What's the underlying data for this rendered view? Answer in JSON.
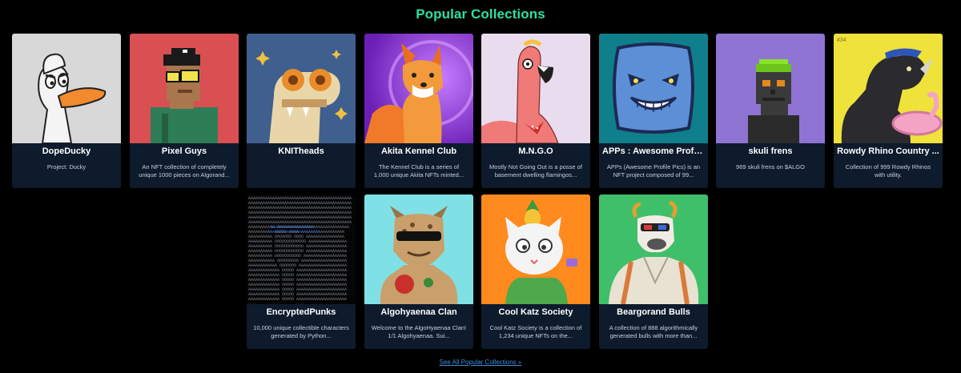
{
  "header": {
    "title": "Popular Collections"
  },
  "collections": [
    {
      "name": "DopeDucky",
      "desc": "Project: Ducky",
      "icon": "duck-art"
    },
    {
      "name": "Pixel Guys",
      "desc": "An NFT collection of completely unique 1000 pieces on Algorand...",
      "icon": "pixel-guy-art"
    },
    {
      "name": "KNITheads",
      "desc": "",
      "icon": "knit-frog-art"
    },
    {
      "name": "Akita Kennel Club",
      "desc": "The Kennel Club is a series of 1,000 unique Akita NFTs minted...",
      "icon": "akita-dog-art"
    },
    {
      "name": "M.N.G.O",
      "desc": "Mostly Not Going Out is a posse of basement dwelling flamingos...",
      "icon": "flamingo-art"
    },
    {
      "name": "APPs : Awesome Profil...",
      "desc": "APPs (Awesome Profile Pics) is an NFT project composed of 99...",
      "icon": "grin-face-art"
    },
    {
      "name": "skuli frens",
      "desc": "969 skuli frens on $ALGO",
      "icon": "pixel-skull-art"
    },
    {
      "name": "Rowdy Rhino Country ...",
      "desc": "Collection of 999 Rowdy Rhinos with utility.",
      "badge": "#34",
      "icon": "rhino-art"
    },
    {
      "name": "EncryptedPunks",
      "desc": "10,000 unique collectible characters generated by Python...",
      "icon": "ascii-punk-art"
    },
    {
      "name": "Algohyaenaa Clan",
      "desc": "Welcome to the AlgoHyaenaa Clan! 1/1 Algohyaenaa. Sui...",
      "icon": "hyena-art"
    },
    {
      "name": "Cool Katz Society",
      "desc": "Cool Katz Society is a collection of 1,234 unique NFTs on the...",
      "icon": "cat-art"
    },
    {
      "name": "Beargorand Bulls",
      "desc": "A collection of 888 algorithmically generated bulls with more than...",
      "icon": "bull-art"
    }
  ],
  "footer": {
    "see_all": "See All Popular Collections »"
  },
  "colors": {
    "title": "#2ce0a0",
    "card_bg": "#0e1b2c",
    "link": "#3e8fe0"
  }
}
